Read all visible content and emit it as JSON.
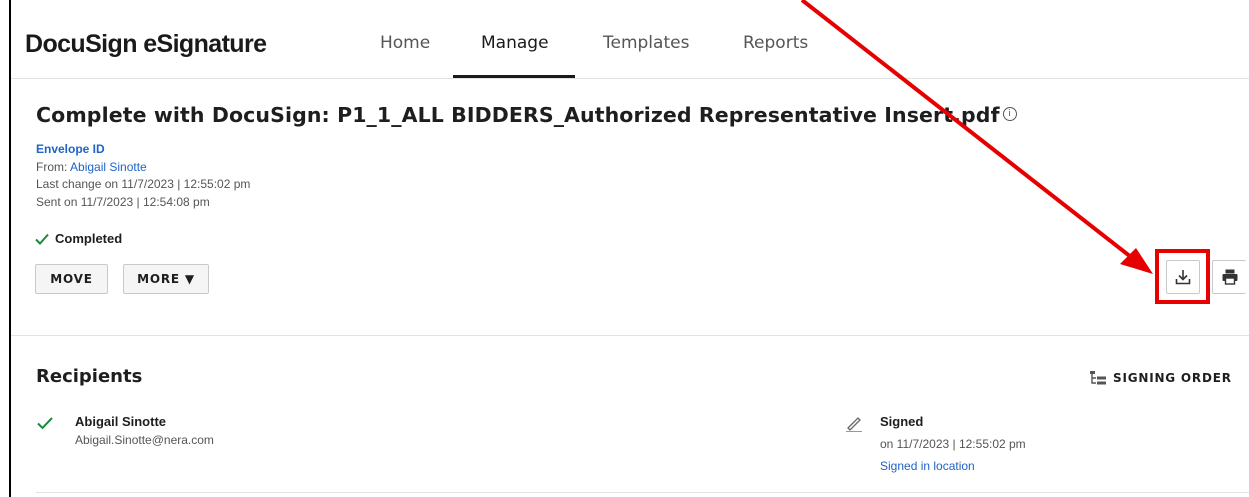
{
  "app": {
    "logo": "DocuSign eSignature"
  },
  "nav": {
    "home": "Home",
    "manage": "Manage",
    "templates": "Templates",
    "reports": "Reports"
  },
  "envelope": {
    "title": "Complete with DocuSign: P1_1_ALL BIDDERS_Authorized Representative Insert.pdf",
    "envelope_id_label": "Envelope ID",
    "from_label": "From: ",
    "from_name": "Abigail Sinotte",
    "last_change": "Last change on 11/7/2023 | 12:55:02 pm",
    "sent_on": "Sent on 11/7/2023 | 12:54:08 pm",
    "status": "Completed"
  },
  "actions": {
    "move": "MOVE",
    "more": "MORE ▼",
    "download_icon": "download-icon",
    "print_icon": "print-icon"
  },
  "recipients": {
    "title": "Recipients",
    "signing_order": "SIGNING ORDER",
    "items": [
      {
        "name": "Abigail Sinotte",
        "email": "Abigail.Sinotte@nera.com",
        "status": "Signed",
        "date": "on 11/7/2023 | 12:55:02 pm",
        "location_link": "Signed in location"
      }
    ]
  },
  "colors": {
    "accent_link": "#1f63c6",
    "success": "#1a8a3c",
    "annotation": "#e60000"
  }
}
